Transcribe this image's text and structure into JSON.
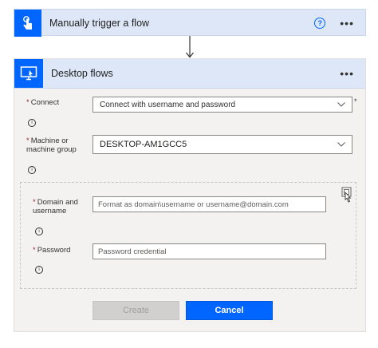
{
  "trigger": {
    "title": "Manually trigger a flow",
    "help_glyph": "?",
    "more_glyph": "•••"
  },
  "desktop": {
    "title": "Desktop flows",
    "more_glyph": "•••"
  },
  "form": {
    "required_mark": "*",
    "connect": {
      "label": "Connect",
      "value": "Connect with username and password"
    },
    "machine": {
      "label_line1": "Machine or",
      "label_line2": "machine group",
      "value": "DESKTOP-AM1GCC5"
    },
    "domain": {
      "label_line1": "Domain and",
      "label_line2": "username",
      "placeholder": "Format as domain\\username or username@domain.com"
    },
    "password": {
      "label": "Password",
      "placeholder": "Password credential"
    },
    "info_glyph": "i",
    "side_star": "*"
  },
  "buttons": {
    "create": "Create",
    "cancel": "Cancel"
  },
  "colors": {
    "accent": "#0066ff",
    "header_bg": "#dde7f7",
    "required": "#a4262c"
  }
}
